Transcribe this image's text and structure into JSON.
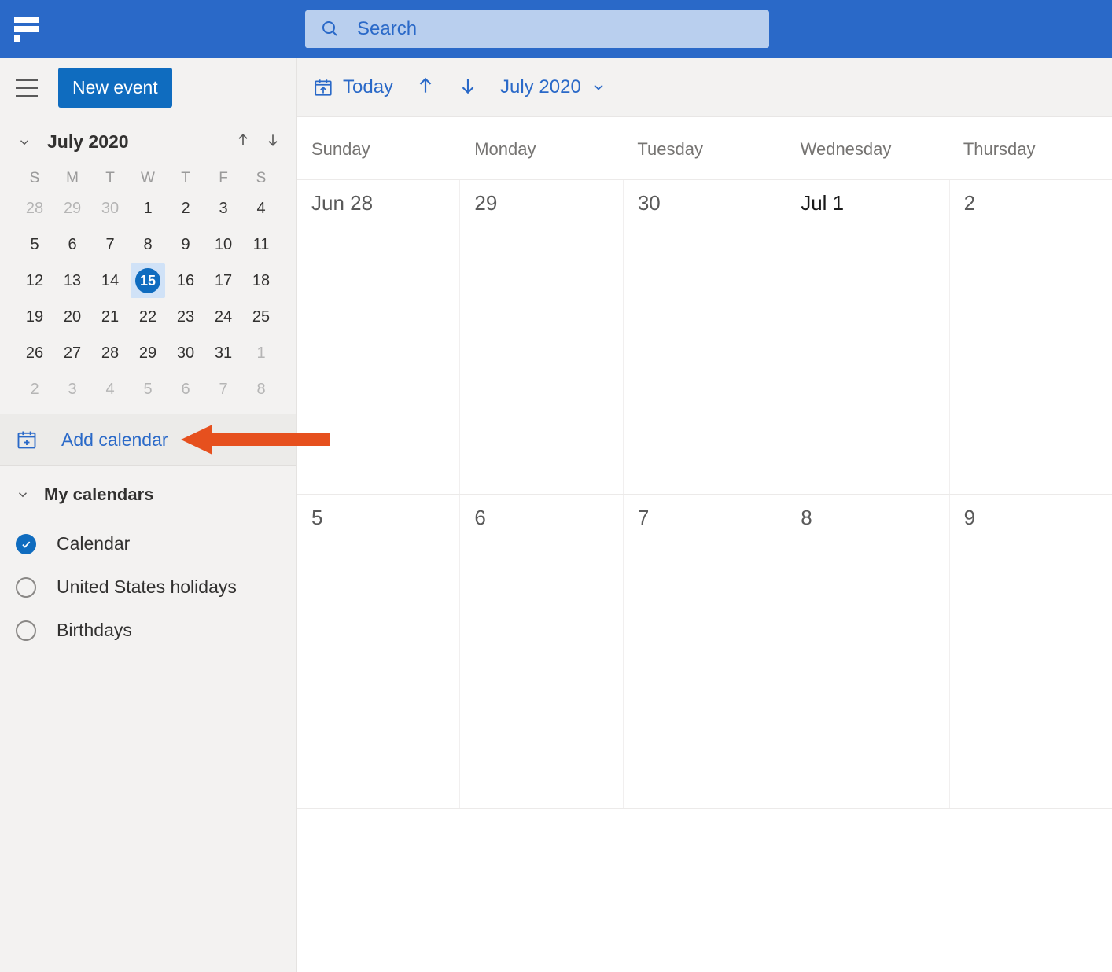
{
  "topbar": {
    "search_placeholder": "Search"
  },
  "sidebar": {
    "new_event_label": "New event",
    "mini_cal": {
      "title": "July 2020",
      "dows": [
        "S",
        "M",
        "T",
        "W",
        "T",
        "F",
        "S"
      ],
      "weeks": [
        [
          {
            "n": "28",
            "o": true
          },
          {
            "n": "29",
            "o": true
          },
          {
            "n": "30",
            "o": true
          },
          {
            "n": "1"
          },
          {
            "n": "2"
          },
          {
            "n": "3"
          },
          {
            "n": "4"
          }
        ],
        [
          {
            "n": "5"
          },
          {
            "n": "6"
          },
          {
            "n": "7"
          },
          {
            "n": "8"
          },
          {
            "n": "9"
          },
          {
            "n": "10"
          },
          {
            "n": "11"
          }
        ],
        [
          {
            "n": "12"
          },
          {
            "n": "13"
          },
          {
            "n": "14"
          },
          {
            "n": "15",
            "sel": true
          },
          {
            "n": "16"
          },
          {
            "n": "17"
          },
          {
            "n": "18"
          }
        ],
        [
          {
            "n": "19"
          },
          {
            "n": "20"
          },
          {
            "n": "21"
          },
          {
            "n": "22"
          },
          {
            "n": "23"
          },
          {
            "n": "24"
          },
          {
            "n": "25"
          }
        ],
        [
          {
            "n": "26"
          },
          {
            "n": "27"
          },
          {
            "n": "28"
          },
          {
            "n": "29"
          },
          {
            "n": "30"
          },
          {
            "n": "31"
          },
          {
            "n": "1",
            "o": true
          }
        ],
        [
          {
            "n": "2",
            "o": true
          },
          {
            "n": "3",
            "o": true
          },
          {
            "n": "4",
            "o": true
          },
          {
            "n": "5",
            "o": true
          },
          {
            "n": "6",
            "o": true
          },
          {
            "n": "7",
            "o": true
          },
          {
            "n": "8",
            "o": true
          }
        ]
      ]
    },
    "add_calendar_label": "Add calendar",
    "my_calendars_title": "My calendars",
    "calendars": [
      {
        "label": "Calendar",
        "checked": true
      },
      {
        "label": "United States holidays",
        "checked": false
      },
      {
        "label": "Birthdays",
        "checked": false
      }
    ]
  },
  "main": {
    "toolbar": {
      "today_label": "Today",
      "month_label": "July 2020"
    },
    "dows": [
      "Sunday",
      "Monday",
      "Tuesday",
      "Wednesday",
      "Thursday"
    ],
    "weeks": [
      [
        {
          "t": "Jun 28"
        },
        {
          "t": "29"
        },
        {
          "t": "30"
        },
        {
          "t": "Jul 1",
          "bold": true
        },
        {
          "t": "2"
        }
      ],
      [
        {
          "t": "5"
        },
        {
          "t": "6"
        },
        {
          "t": "7"
        },
        {
          "t": "8"
        },
        {
          "t": "9"
        }
      ]
    ]
  },
  "colors": {
    "brand_blue": "#2a69c8",
    "accent_blue": "#0f6cbf",
    "annotation_orange": "#e6501e"
  }
}
